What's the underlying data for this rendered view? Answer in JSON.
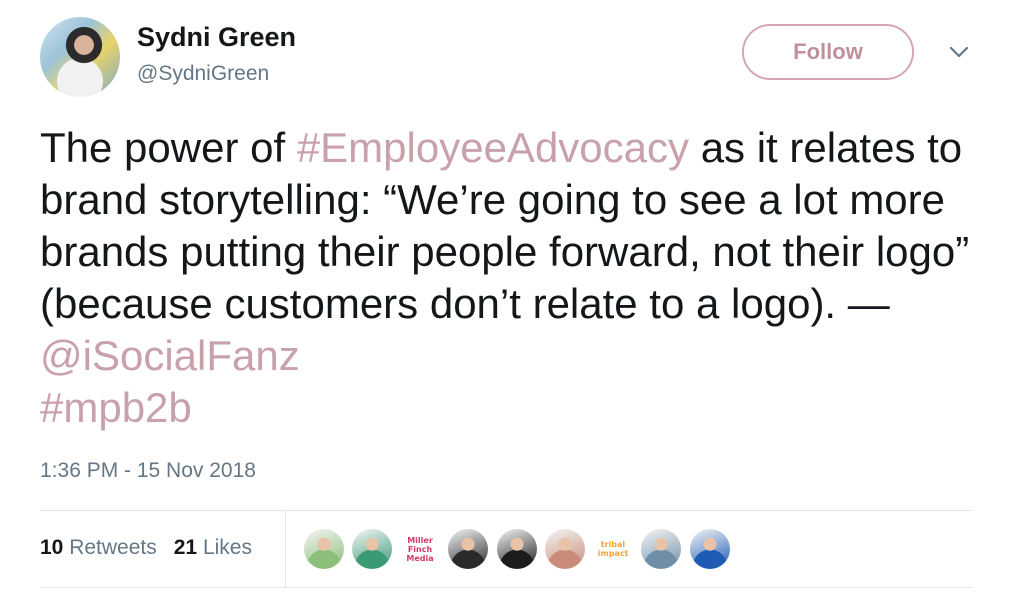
{
  "author": {
    "name": "Sydni Green",
    "handle": "@SydniGreen",
    "follow_label": "Follow"
  },
  "tweet": {
    "text_before": "The power of ",
    "hashtag1": "#EmployeeAdvocacy",
    "text_middle": " as it relates to brand storytelling: “We’re going to see a lot more brands putting their people forward, not their logo” (because customers don’t relate to a logo). — ",
    "mention": "@iSocialFanz",
    "hashtag2": "#mpb2b",
    "timestamp": "1:36 PM - 15 Nov 2018"
  },
  "stats": {
    "retweets_count": "10",
    "retweets_label": "Retweets",
    "likes_count": "21",
    "likes_label": "Likes"
  },
  "likers": [
    {
      "icon": "avatar-photo",
      "color": "#8bbf7a"
    },
    {
      "icon": "avatar-photo",
      "color": "#3a9a74"
    },
    {
      "icon": "miller-finch-media-logo",
      "text": "Miller Finch Media",
      "color": "#d63a6a"
    },
    {
      "icon": "avatar-photo",
      "color": "#2a2a2a"
    },
    {
      "icon": "avatar-photo",
      "color": "#1c1c1c"
    },
    {
      "icon": "avatar-photo",
      "color": "#c98b7a"
    },
    {
      "icon": "tribal-impact-logo",
      "text": "tribal impact",
      "color": "#f2a33a"
    },
    {
      "icon": "avatar-photo",
      "color": "#6f8fa8"
    },
    {
      "icon": "avatar-photo",
      "color": "#1d5bb5"
    }
  ],
  "colors": {
    "link": "#c8a1ab",
    "follow_border": "#d7a5b1",
    "secondary_text": "#657786",
    "primary_text": "#14171a"
  }
}
